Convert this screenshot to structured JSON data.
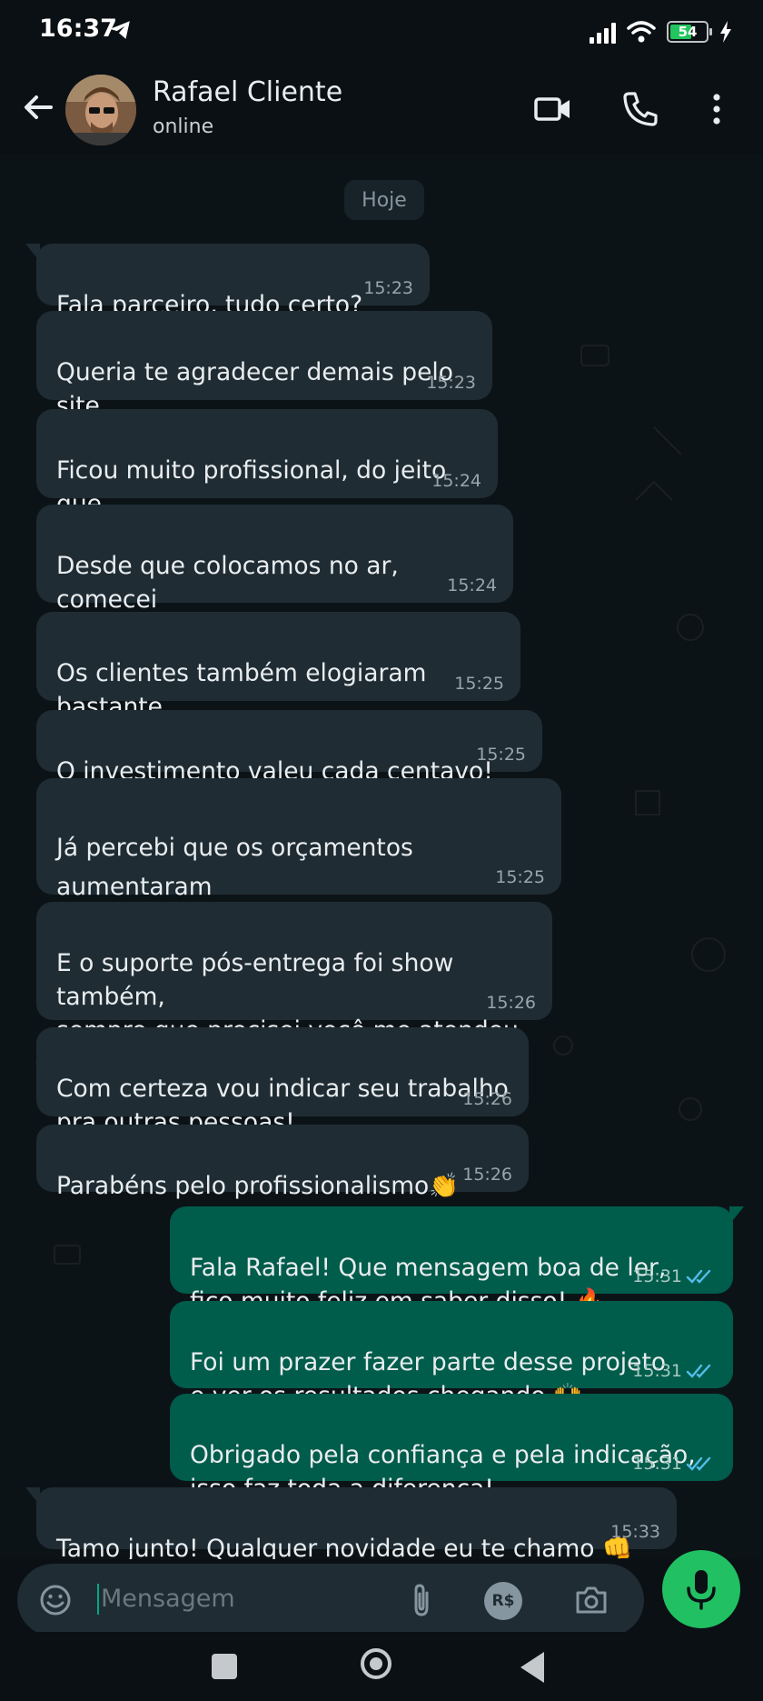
{
  "status_bar": {
    "time": "16:37",
    "battery": "54"
  },
  "header": {
    "name": "Rafael Cliente",
    "status": "online"
  },
  "chat": {
    "day_label": "Hoje",
    "messages": [
      {
        "text": "Fala parceiro, tudo certo?",
        "time": "15:23"
      },
      {
        "text": "Queria te agradecer demais pelo site\nque você desenvolveu pra gente!",
        "time": "15:23"
      },
      {
        "text": "Ficou muito profissional, do jeito que\neu queria mesmo.",
        "time": "15:24"
      },
      {
        "text": "Desde que colocamos no ar, comecei\na receber muito mais contatos pelo site.",
        "time": "15:24"
      },
      {
        "text": "Os clientes também elogiaram bastante\no visual e a facilidade de usar.",
        "time": "15:25"
      },
      {
        "text": "O investimento valeu cada centavo!",
        "time": "15:25"
      },
      {
        "text": "Já percebi que os orçamentos aumentaram\nbastante, e isso tá refletindo nas vendas 🙏",
        "time": "15:25"
      },
      {
        "text": "E o suporte pós-entrega foi show também,\nsempre que precisei você me atendeu\nrapidinho.",
        "time": "15:26"
      },
      {
        "text": "Com certeza vou indicar seu trabalho\npra outras pessoas!",
        "time": "15:26"
      },
      {
        "text": "Parabéns pelo profissionalismo👏",
        "time": "15:26"
      },
      {
        "text": "Fala Rafael! Que mensagem boa de ler,\nfico muito feliz em saber disso! 🔥",
        "time": "15:31"
      },
      {
        "text": "Foi um prazer fazer parte desse projeto\ne ver os resultados chegando 🙌",
        "time": "15:31"
      },
      {
        "text": "Obrigado pela confiança e pela indicação,\nisso faz toda a diferença!",
        "time": "15:31"
      },
      {
        "text": "Tamo junto! Qualquer novidade eu te chamo 👊",
        "time": "15:33"
      }
    ]
  },
  "composer": {
    "placeholder": "Mensagem",
    "currency_icon_text": "R$"
  },
  "colors": {
    "incoming": "#1f2c34",
    "outgoing": "#005c4b",
    "accent": "#21c063",
    "read_ticks": "#53bdeb"
  },
  "icons": [
    "telegram-icon",
    "signal-icon",
    "wifi-icon",
    "battery-icon",
    "charging-icon",
    "back-arrow-icon",
    "video-call-icon",
    "phone-icon",
    "more-options-icon",
    "emoji-icon",
    "attach-icon",
    "payment-icon",
    "camera-icon",
    "mic-icon",
    "double-check-icon"
  ]
}
